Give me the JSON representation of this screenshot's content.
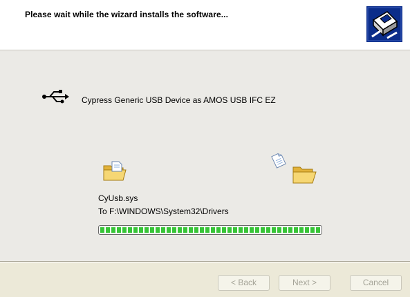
{
  "header": {
    "title": "Please wait while the wizard installs the software...",
    "icon": "hardware-wizard-icon"
  },
  "device": {
    "icon": "usb-icon",
    "name": "Cypress Generic USB Device as AMOS USB IFC EZ"
  },
  "copy": {
    "source_icon": "folder-icon",
    "flying_icon": "document-icon",
    "dest_icon": "folder-icon",
    "file_name": "CyUsb.sys",
    "destination": "To F:\\WINDOWS\\System32\\Drivers",
    "progress": 1.0
  },
  "buttons": {
    "back": "< Back",
    "next": "Next >",
    "cancel": "Cancel"
  },
  "colors": {
    "progress_fill": "#37c437",
    "content_bg": "#ebeae6",
    "header_icon_bg": "#0b2d8a"
  }
}
